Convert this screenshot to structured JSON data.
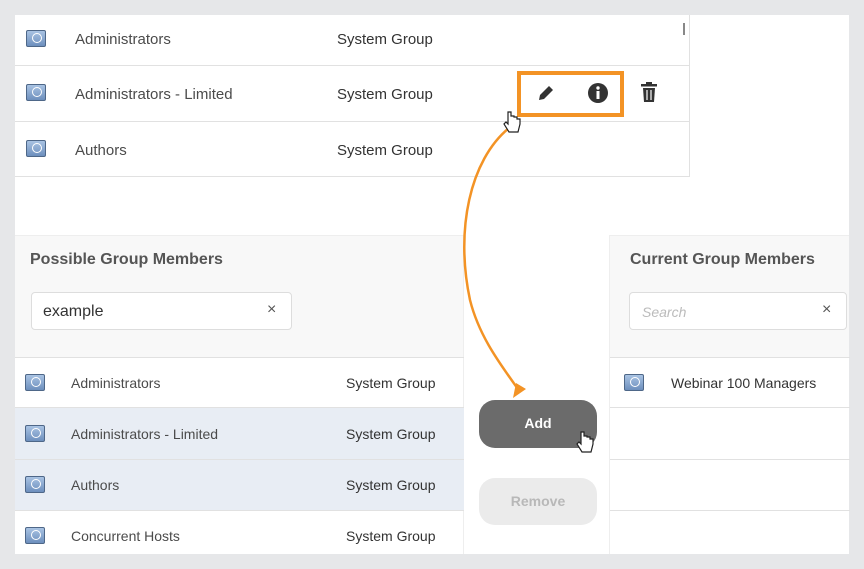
{
  "top_table": {
    "rows": [
      {
        "name": "Administrators",
        "type": "System Group"
      },
      {
        "name": "Administrators - Limited",
        "type": "System Group"
      },
      {
        "name": "Authors",
        "type": "System Group"
      }
    ]
  },
  "possible": {
    "title": "Possible Group Members",
    "search_value": "example",
    "clear": "×",
    "rows": [
      {
        "name": "Administrators",
        "type": "System Group",
        "selected": false
      },
      {
        "name": "Administrators - Limited",
        "type": "System Group",
        "selected": true
      },
      {
        "name": "Authors",
        "type": "System Group",
        "selected": true
      },
      {
        "name": "Concurrent Hosts",
        "type": "System Group",
        "selected": false
      }
    ]
  },
  "current": {
    "title": "Current Group Members",
    "search_placeholder": "Search",
    "clear": "×",
    "rows": [
      {
        "name": "Webinar 100 Managers"
      }
    ]
  },
  "actions": {
    "add": "Add",
    "remove": "Remove"
  },
  "colors": {
    "highlight": "#f39325",
    "selected_row": "#e8edf4",
    "add_button": "#6b6b6b"
  }
}
